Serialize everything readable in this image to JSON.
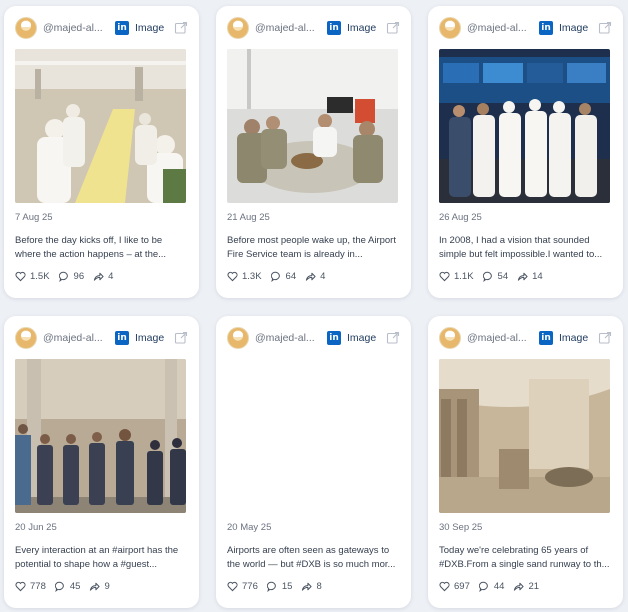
{
  "cards": [
    {
      "handle": "@majed-al...",
      "type_label": "Image",
      "date": "7 Aug 25",
      "caption": "Before the day kicks off, I like to be where the action happens – at the...",
      "likes": "1.5K",
      "comments": "96",
      "shares": "4",
      "image": "meeting-terminal"
    },
    {
      "handle": "@majed-al...",
      "type_label": "Image",
      "date": "21 Aug 25",
      "caption": "Before most people wake up, the Airport Fire Service team is already in...",
      "likes": "1.3K",
      "comments": "64",
      "shares": "4",
      "image": "fire-service-breakfast"
    },
    {
      "handle": "@majed-al...",
      "type_label": "Image",
      "date": "26 Aug 25",
      "caption": "In 2008, I had a vision that sounded simple but felt impossible.I wanted to...",
      "likes": "1.1K",
      "comments": "54",
      "shares": "14",
      "image": "control-room"
    },
    {
      "handle": "@majed-al...",
      "type_label": "Image",
      "date": "20 Jun 25",
      "caption": "Every interaction at an #airport has the potential to shape how a #guest...",
      "likes": "778",
      "comments": "45",
      "shares": "9",
      "image": "staff-lineup"
    },
    {
      "handle": "@majed-al...",
      "type_label": "Image",
      "date": "20 May 25",
      "caption": "Airports are often seen as gateways to the world — but #DXB is so much mor...",
      "likes": "776",
      "comments": "15",
      "shares": "8",
      "image": "blank"
    },
    {
      "handle": "@majed-al...",
      "type_label": "Image",
      "date": "30 Sep 25",
      "caption": "Today we're celebrating 65 years of #DXB.From a single sand runway to th...",
      "likes": "697",
      "comments": "44",
      "shares": "21",
      "image": "sepia-terminal"
    }
  ],
  "colors": {
    "linkedin": "#0a66c2",
    "accent_text": "#1e3a5f",
    "background": "#edf0f5"
  },
  "icons": {
    "network": "linkedin-icon",
    "open": "external-link-icon",
    "likes": "heart-icon",
    "comments": "comment-icon",
    "shares": "share-icon"
  }
}
